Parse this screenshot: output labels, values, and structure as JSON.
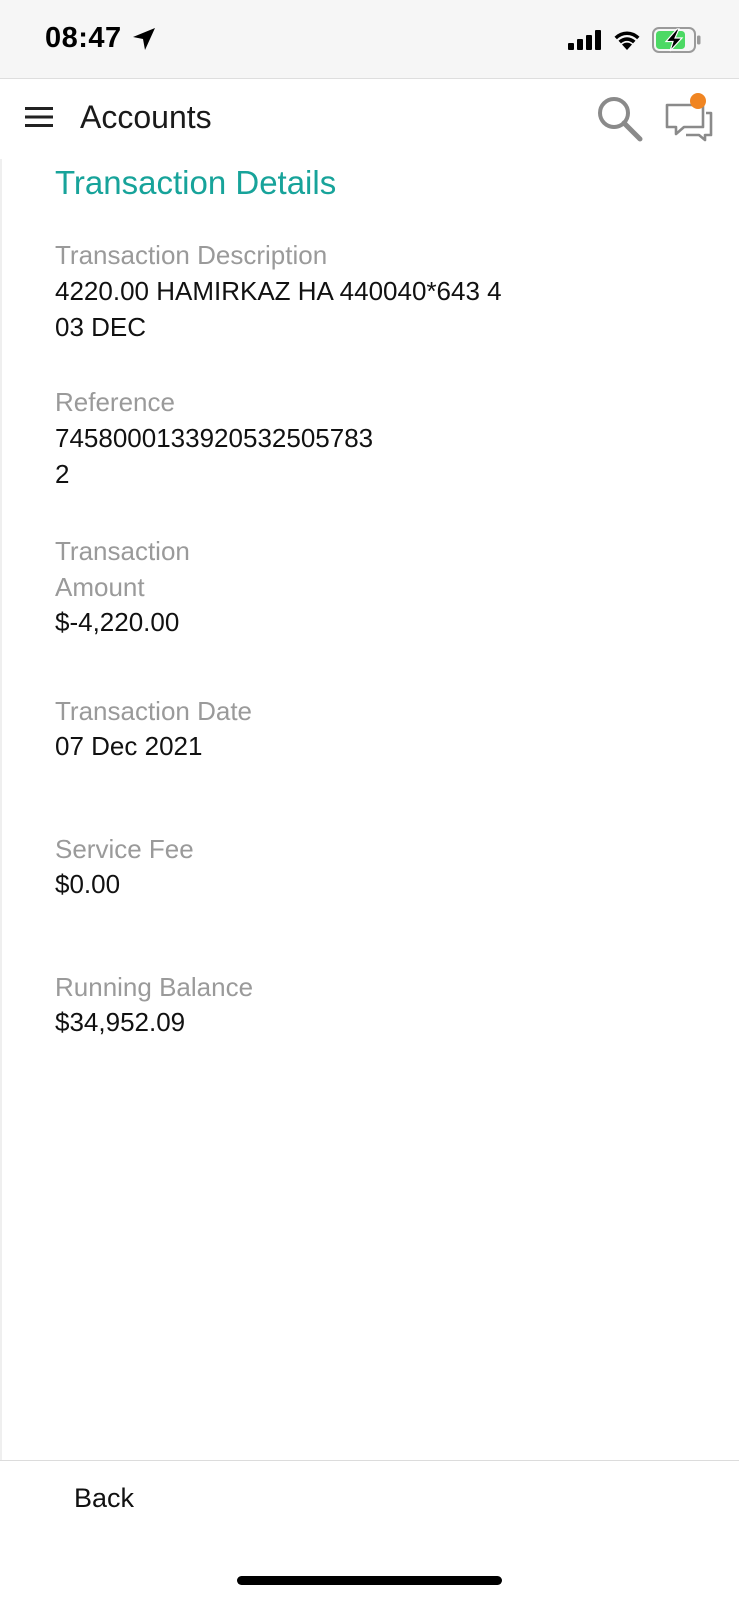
{
  "status_bar": {
    "time": "08:47"
  },
  "header": {
    "title": "Accounts"
  },
  "details": {
    "section_title": "Transaction Details",
    "description_label": "Transaction Description",
    "description_line1": "4220.00 HAMIRKAZ HA 440040*643 4",
    "description_line2": "03 DEC",
    "reference_label": "Reference",
    "reference_line1": "745800013392053250578­3",
    "reference_line2": "2",
    "amount_label_line1": "Transaction",
    "amount_label_line2": "Amount",
    "amount_value": "$-4,220.00",
    "date_label": "Transaction Date",
    "date_value": "07 Dec 2021",
    "fee_label": "Service Fee",
    "fee_value": "$0.00",
    "balance_label": "Running Balance",
    "balance_value": "$34,952.09"
  },
  "footer": {
    "back_label": "Back"
  },
  "colors": {
    "accent": "#17a39a",
    "notification_dot": "#f08522",
    "battery_fill": "#4cd964"
  }
}
